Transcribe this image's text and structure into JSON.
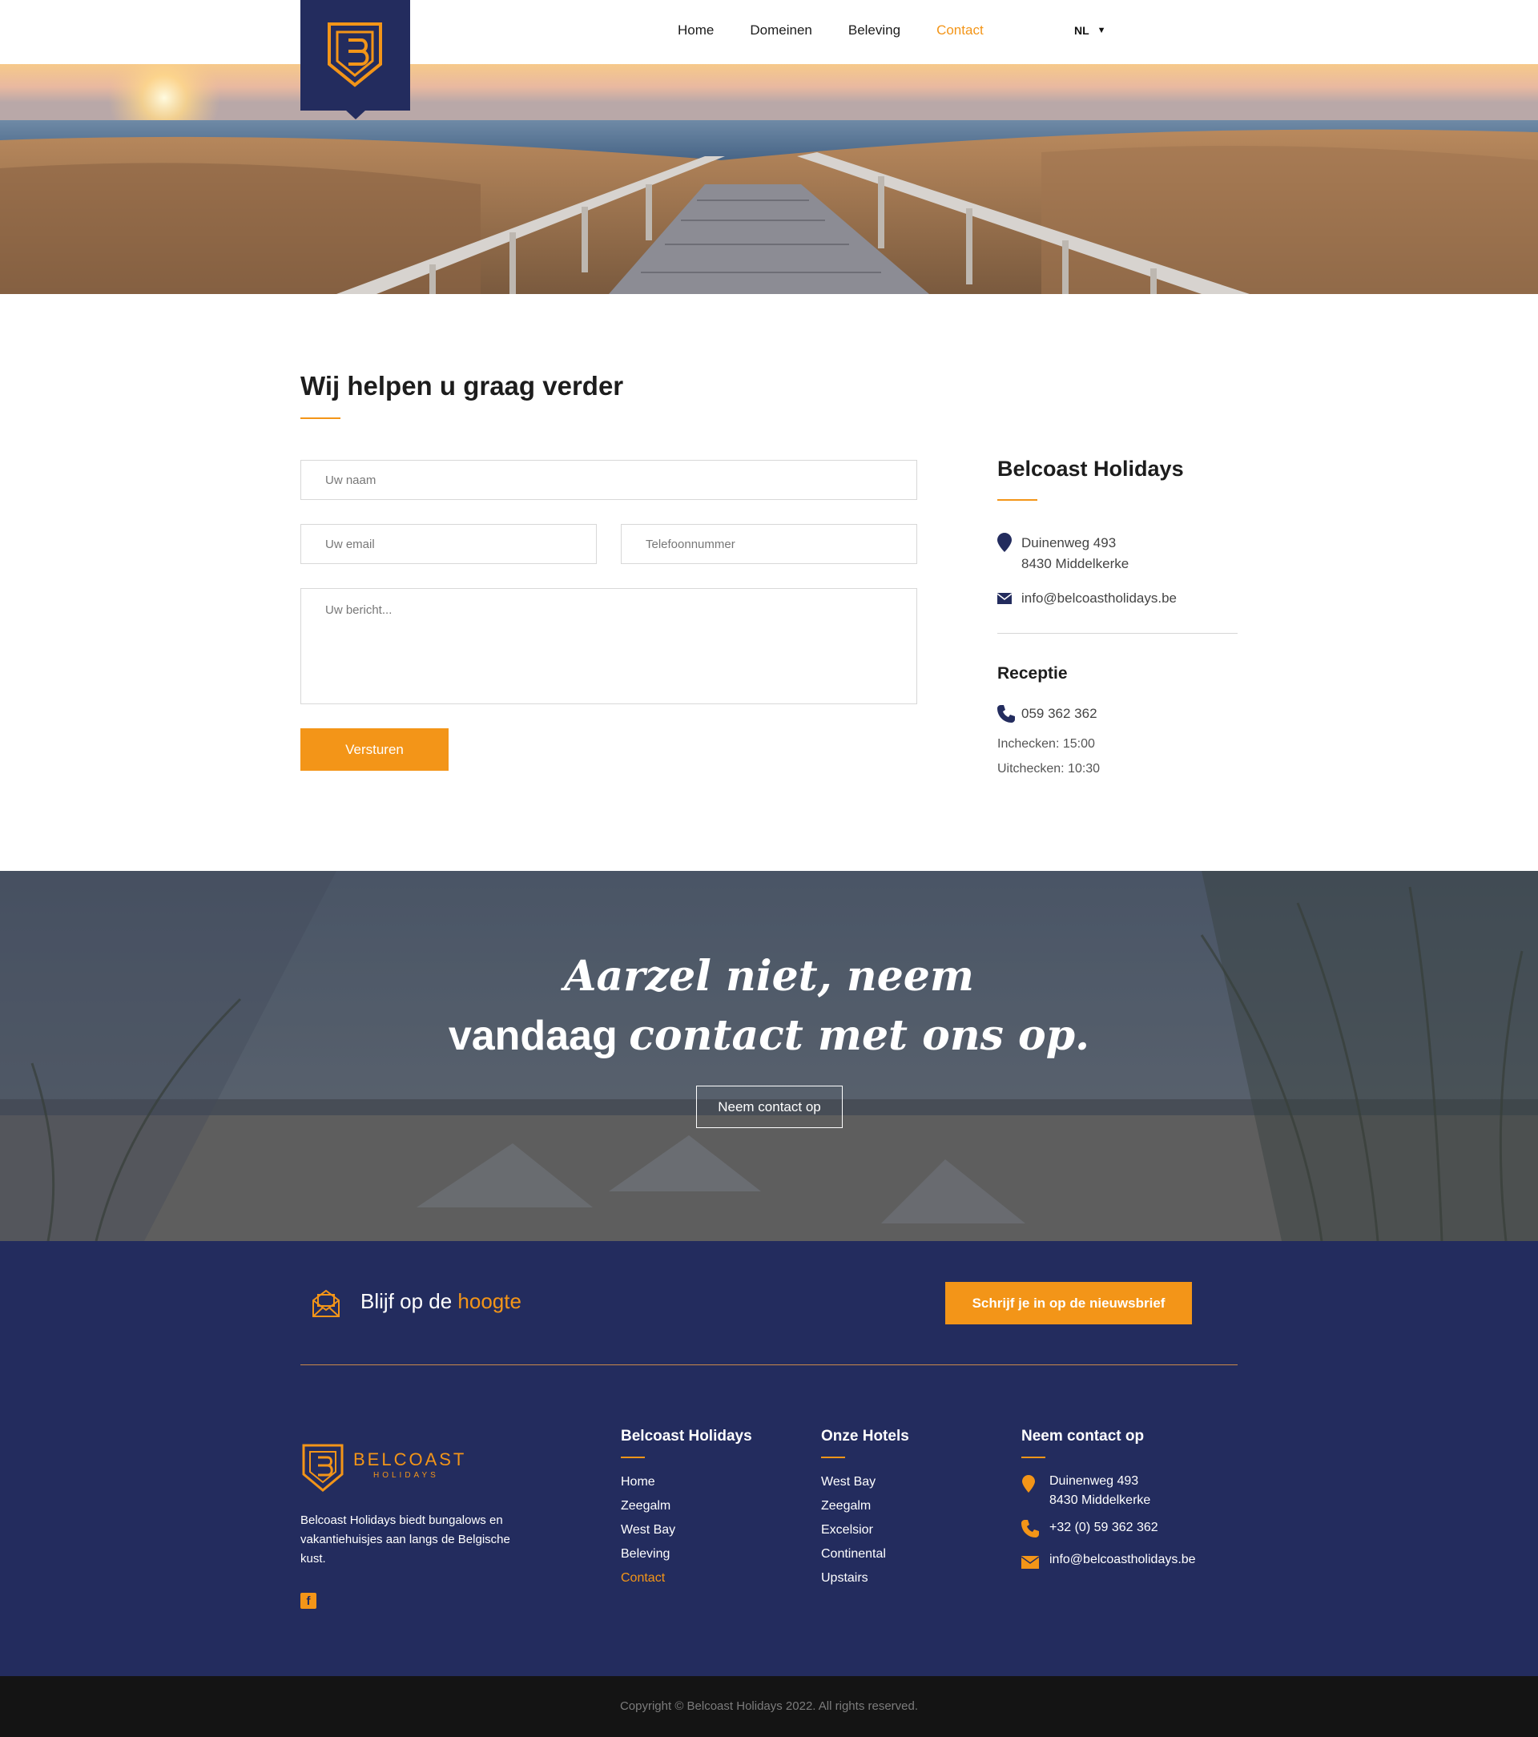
{
  "nav": {
    "items": [
      "Home",
      "Domeinen",
      "Beleving",
      "Contact"
    ],
    "active_index": 3,
    "language": "NL"
  },
  "contact": {
    "title": "Wij helpen u graag verder",
    "form": {
      "name_placeholder": "Uw naam",
      "email_placeholder": "Uw email",
      "phone_placeholder": "Telefoonnummer",
      "message_placeholder": "Uw bericht...",
      "submit_label": "Versturen"
    },
    "side": {
      "title": "Belcoast Holidays",
      "address_line1": "Duinenweg 493",
      "address_line2": "8430 Middelkerke",
      "email": "info@belcoastholidays.be",
      "reception_title": "Receptie",
      "phone": "059 362 362",
      "checkin": "Inchecken: 15:00",
      "checkout": "Uitchecken: 10:30"
    }
  },
  "cta": {
    "line1": "Aarzel niet, neem",
    "line2_plain": "vandaag",
    "line2_italic": "contact met ons op.",
    "button_label": "Neem contact op"
  },
  "newsletter": {
    "text_prefix": "Blijf op de",
    "text_highlight": "hoogte",
    "button_label": "Schrijf je in op de nieuwsbrief"
  },
  "footer": {
    "brand_name": "BELCOAST",
    "brand_sub": "HOLIDAYS",
    "description": "Belcoast Holidays biedt bungalows en vakantiehuisjes aan langs de Belgische kust.",
    "columns": {
      "company": {
        "title": "Belcoast Holidays",
        "links": [
          "Home",
          "Zeegalm",
          "West Bay",
          "Beleving",
          "Contact"
        ],
        "active_index": 4
      },
      "hotels": {
        "title": "Onze Hotels",
        "links": [
          "West Bay",
          "Zeegalm",
          "Excelsior",
          "Continental",
          "Upstairs"
        ]
      },
      "contact": {
        "title": "Neem contact op",
        "address_line1": "Duinenweg 493",
        "address_line2": "8430 Middelkerke",
        "phone": "+32 (0) 59 362 362",
        "email": "info@belcoastholidays.be"
      }
    },
    "copyright": "Copyright © Belcoast Holidays 2022. All rights reserved."
  },
  "colors": {
    "accent": "#f39518",
    "navy": "#232c5e",
    "copyright_bar": "#141414"
  },
  "icons": [
    "logo-shield-icon",
    "chevron-down-icon",
    "map-pin-icon",
    "envelope-icon",
    "phone-icon",
    "newsletter-envelope-icon",
    "facebook-icon"
  ]
}
